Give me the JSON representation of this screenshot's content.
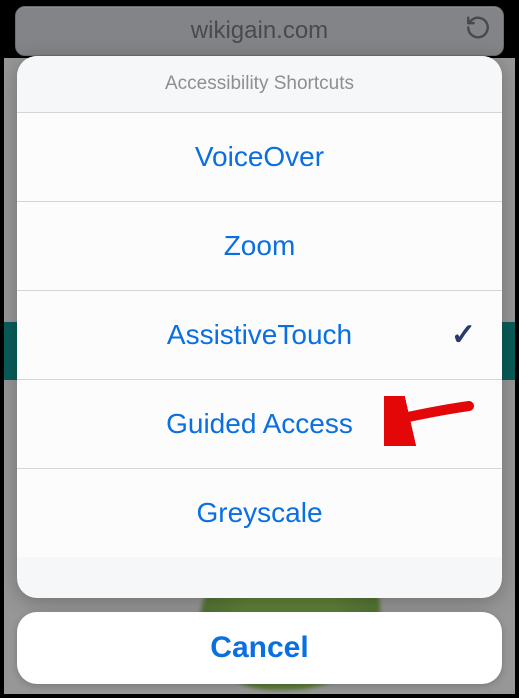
{
  "urlbar": {
    "domain": "wikigain.com"
  },
  "sheet": {
    "title": "Accessibility Shortcuts",
    "items": [
      {
        "label": "VoiceOver",
        "checked": false
      },
      {
        "label": "Zoom",
        "checked": false
      },
      {
        "label": "AssistiveTouch",
        "checked": true
      },
      {
        "label": "Guided Access",
        "checked": false
      },
      {
        "label": "Greyscale",
        "checked": false
      }
    ],
    "cancel_label": "Cancel"
  },
  "annotation": {
    "points_to": "Guided Access",
    "color": "#e30707"
  }
}
